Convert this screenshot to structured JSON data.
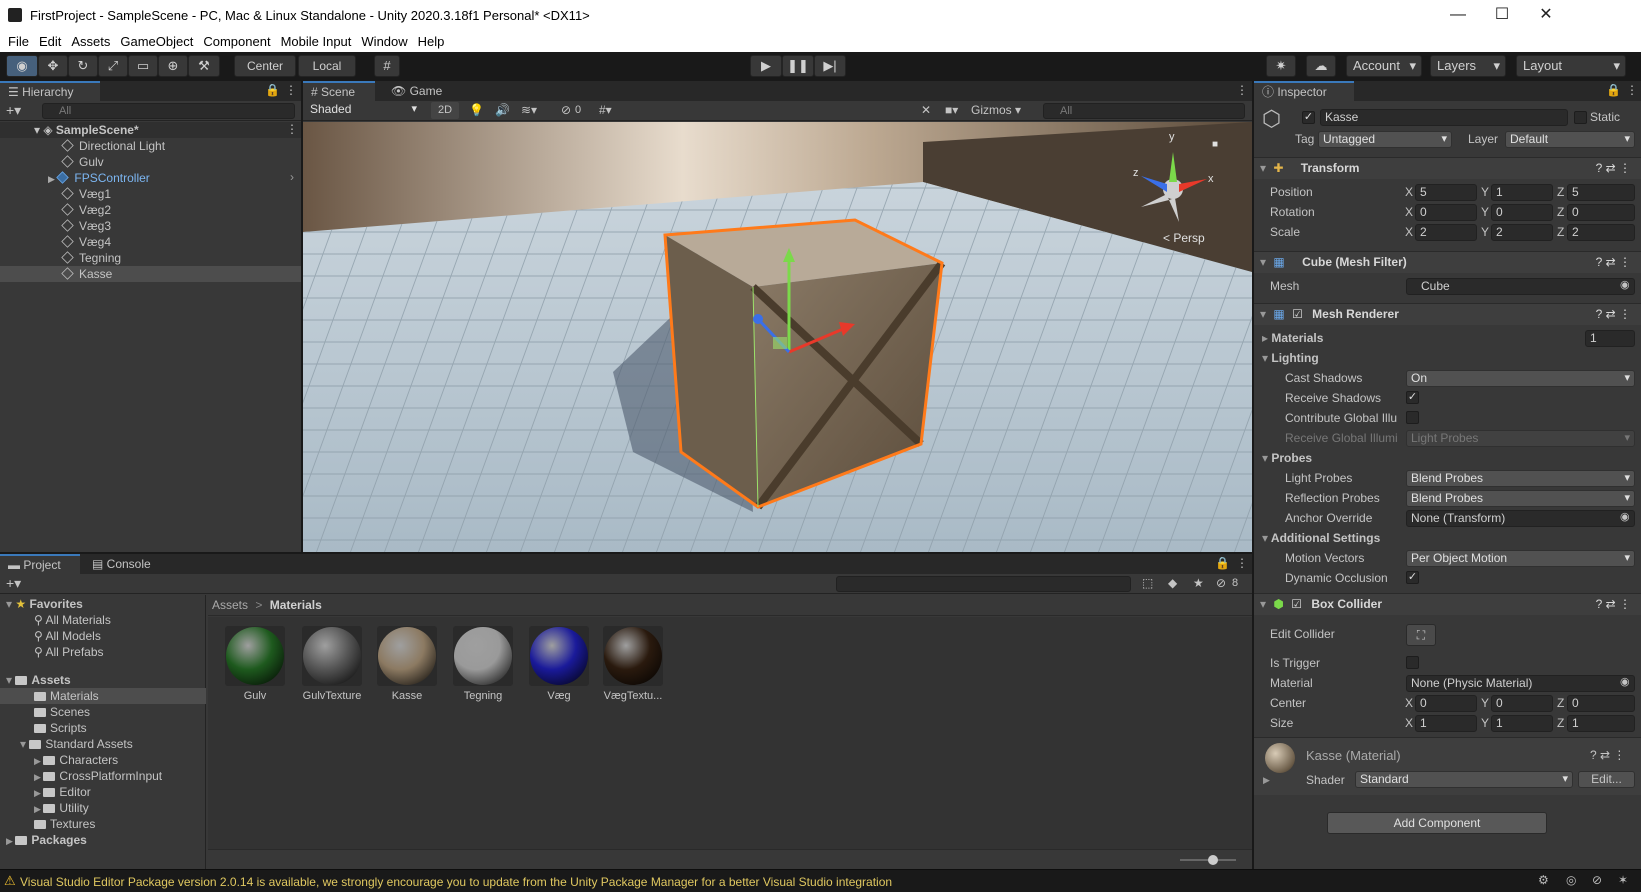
{
  "window": {
    "title": "FirstProject - SampleScene - PC, Mac & Linux Standalone - Unity 2020.3.18f1 Personal* <DX11>",
    "minimize": "—",
    "maximize": "☐",
    "close": "✕"
  },
  "menu": [
    "File",
    "Edit",
    "Assets",
    "GameObject",
    "Component",
    "Mobile Input",
    "Window",
    "Help"
  ],
  "toolbar": {
    "pivot_mode": "Center",
    "pivot_rotation": "Local",
    "account": "Account",
    "layers": "Layers",
    "layout": "Layout"
  },
  "hierarchy": {
    "tab": "Hierarchy",
    "search_placeholder": "All",
    "scene": "SampleScene*",
    "items": [
      "Directional Light",
      "Gulv",
      "FPSController",
      "Væg1",
      "Væg2",
      "Væg3",
      "Væg4",
      "Tegning",
      "Kasse"
    ]
  },
  "scene_view": {
    "tabs": [
      "Scene",
      "Game"
    ],
    "draw_mode": "Shaded",
    "toggle_2d": "2D",
    "hidden_count": "0",
    "gizmos": "Gizmos",
    "search_placeholder": "All",
    "projection": "Persp",
    "axis_x": "x",
    "axis_y": "y",
    "axis_z": "z"
  },
  "inspector": {
    "tab": "Inspector",
    "object_name": "Kasse",
    "static_label": "Static",
    "tag_label": "Tag",
    "tag_value": "Untagged",
    "layer_label": "Layer",
    "layer_value": "Default",
    "transform": {
      "title": "Transform",
      "position_label": "Position",
      "position": [
        "5",
        "1",
        "5"
      ],
      "rotation_label": "Rotation",
      "rotation": [
        "0",
        "0",
        "0"
      ],
      "scale_label": "Scale",
      "scale": [
        "2",
        "2",
        "2"
      ]
    },
    "mesh_filter": {
      "title": "Cube (Mesh Filter)",
      "mesh_label": "Mesh",
      "mesh_value": "Cube"
    },
    "mesh_renderer": {
      "title": "Mesh Renderer",
      "materials_label": "Materials",
      "materials_count": "1",
      "lighting_label": "Lighting",
      "cast_shadows_label": "Cast Shadows",
      "cast_shadows": "On",
      "receive_shadows_label": "Receive Shadows",
      "contribute_gi_label": "Contribute Global Illu",
      "receive_gi_label": "Receive Global Illumi",
      "receive_gi": "Light Probes",
      "probes_label": "Probes",
      "light_probes_label": "Light Probes",
      "light_probes": "Blend Probes",
      "reflection_probes_label": "Reflection Probes",
      "reflection_probes": "Blend Probes",
      "anchor_override_label": "Anchor Override",
      "anchor_override": "None (Transform)",
      "additional_label": "Additional Settings",
      "motion_vectors_label": "Motion Vectors",
      "motion_vectors": "Per Object Motion",
      "dynamic_occlusion_label": "Dynamic Occlusion"
    },
    "box_collider": {
      "title": "Box Collider",
      "edit_collider_label": "Edit Collider",
      "is_trigger_label": "Is Trigger",
      "material_label": "Material",
      "material_value": "None (Physic Material)",
      "center_label": "Center",
      "center": [
        "0",
        "0",
        "0"
      ],
      "size_label": "Size",
      "size": [
        "1",
        "1",
        "1"
      ]
    },
    "material": {
      "title": "Kasse (Material)",
      "shader_label": "Shader",
      "shader_value": "Standard",
      "edit_label": "Edit..."
    },
    "add_component": "Add Component"
  },
  "project": {
    "tabs": [
      "Project",
      "Console"
    ],
    "hidden_count": "8",
    "favorites": "Favorites",
    "favorite_items": [
      "All Materials",
      "All Models",
      "All Prefabs"
    ],
    "assets": "Assets",
    "asset_folders": [
      "Materials",
      "Scenes",
      "Scripts",
      "Standard Assets"
    ],
    "standard_assets_children": [
      "Characters",
      "CrossPlatformInput",
      "Editor",
      "Utility"
    ],
    "textures": "Textures",
    "packages": "Packages",
    "breadcrumb": [
      "Assets",
      "Materials"
    ],
    "breadcrumb_sep": ">",
    "materials": [
      {
        "name": "Gulv",
        "color": "#1e5a1e"
      },
      {
        "name": "GulvTexture",
        "color": "#555555"
      },
      {
        "name": "Kasse",
        "color": "#8c7a62"
      },
      {
        "name": "Tegning",
        "color": "#9a9a9a"
      },
      {
        "name": "Væg",
        "color": "#1a1a9a"
      },
      {
        "name": "VægTextu...",
        "color": "#2a1a0e"
      }
    ]
  },
  "status": {
    "message": "Visual Studio Editor Package version 2.0.14 is available, we strongly encourage you to update from the Unity Package Manager for a better Visual Studio integration"
  }
}
